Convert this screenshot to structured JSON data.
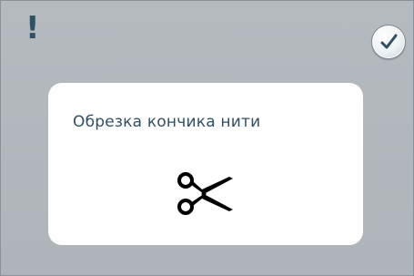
{
  "header": {
    "alert_symbol": "!",
    "alert_icon": "exclamation-icon",
    "confirm_icon": "checkmark-icon"
  },
  "dialog": {
    "title": "Обрезка кончика нити",
    "icon": "scissors-icon"
  },
  "colors": {
    "background": "#b2b8bc",
    "accent": "#2f4f64",
    "dialog_background": "#ffffff"
  }
}
